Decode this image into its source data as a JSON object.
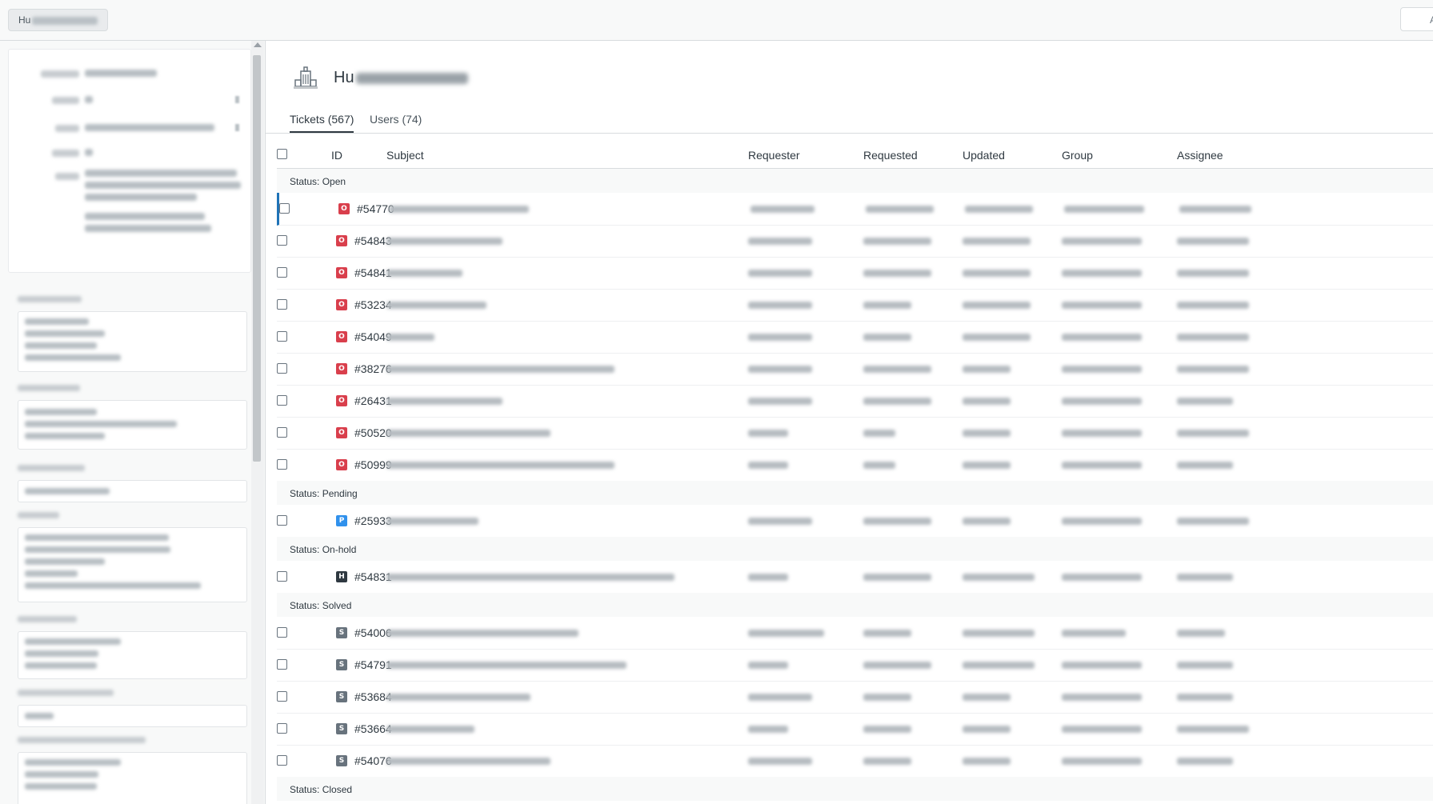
{
  "topbar": {
    "breadcrumb_prefix": "Hu",
    "right_button_label": "A"
  },
  "org": {
    "name_prefix": "Hu"
  },
  "tabs": [
    {
      "label": "Tickets (567)",
      "active": true
    },
    {
      "label": "Users (74)",
      "active": false
    }
  ],
  "table": {
    "columns": [
      "ID",
      "Subject",
      "Requester",
      "Requested",
      "Updated",
      "Group",
      "Assignee"
    ],
    "groups": [
      {
        "label": "Status: Open",
        "tickets": [
          {
            "id": "#54770",
            "badge": "O",
            "selected": true
          },
          {
            "id": "#54843",
            "badge": "O"
          },
          {
            "id": "#54841",
            "badge": "O"
          },
          {
            "id": "#53234",
            "badge": "O"
          },
          {
            "id": "#54049",
            "badge": "O"
          },
          {
            "id": "#38276",
            "badge": "O"
          },
          {
            "id": "#26431",
            "badge": "O"
          },
          {
            "id": "#50520",
            "badge": "O"
          },
          {
            "id": "#50999",
            "badge": "O"
          }
        ]
      },
      {
        "label": "Status: Pending",
        "tickets": [
          {
            "id": "#25933",
            "badge": "P"
          }
        ]
      },
      {
        "label": "Status: On-hold",
        "tickets": [
          {
            "id": "#54831",
            "badge": "H"
          }
        ]
      },
      {
        "label": "Status: Solved",
        "tickets": [
          {
            "id": "#54006",
            "badge": "S"
          },
          {
            "id": "#54791",
            "badge": "S"
          },
          {
            "id": "#53684",
            "badge": "S"
          },
          {
            "id": "#53664",
            "badge": "S"
          },
          {
            "id": "#54076",
            "badge": "S"
          }
        ]
      },
      {
        "label": "Status: Closed",
        "tickets": []
      }
    ]
  },
  "colors": {
    "open": "#d93f4c",
    "pending": "#3091ec",
    "on_hold": "#2f3941",
    "solved": "#68737d",
    "selected_bar": "#1f73b7"
  },
  "icons": {
    "org": "building-icon"
  }
}
